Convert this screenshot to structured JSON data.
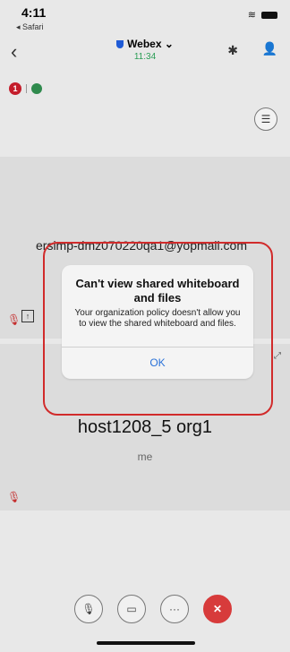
{
  "status_bar": {
    "time": "4:11",
    "back_app": "◂ Safari"
  },
  "header": {
    "title": "Webex",
    "subtitle": "11:34"
  },
  "badges": {
    "red_count": "1"
  },
  "participant_1": {
    "name": "ersimp-dmz070220qa1@yopmail.com"
  },
  "participant_2": {
    "name": "host1208_5 org1",
    "label": "me"
  },
  "dialog": {
    "title": "Can't view shared whiteboard and files",
    "message": "Your organization policy doesn't allow you to view the shared whiteboard and files.",
    "ok_label": "OK"
  },
  "colors": {
    "accent_blue": "#2a72d8",
    "leave_red": "#d73b3b",
    "highlight_red": "#d12b2b",
    "status_green": "#2a9d55"
  },
  "icons": [
    "back-icon",
    "bluetooth-icon",
    "people-icon",
    "layout-icon",
    "mic-muted-icon",
    "share-icon",
    "expand-icon",
    "mute-icon",
    "video-off-icon",
    "more-icon",
    "close-icon"
  ]
}
